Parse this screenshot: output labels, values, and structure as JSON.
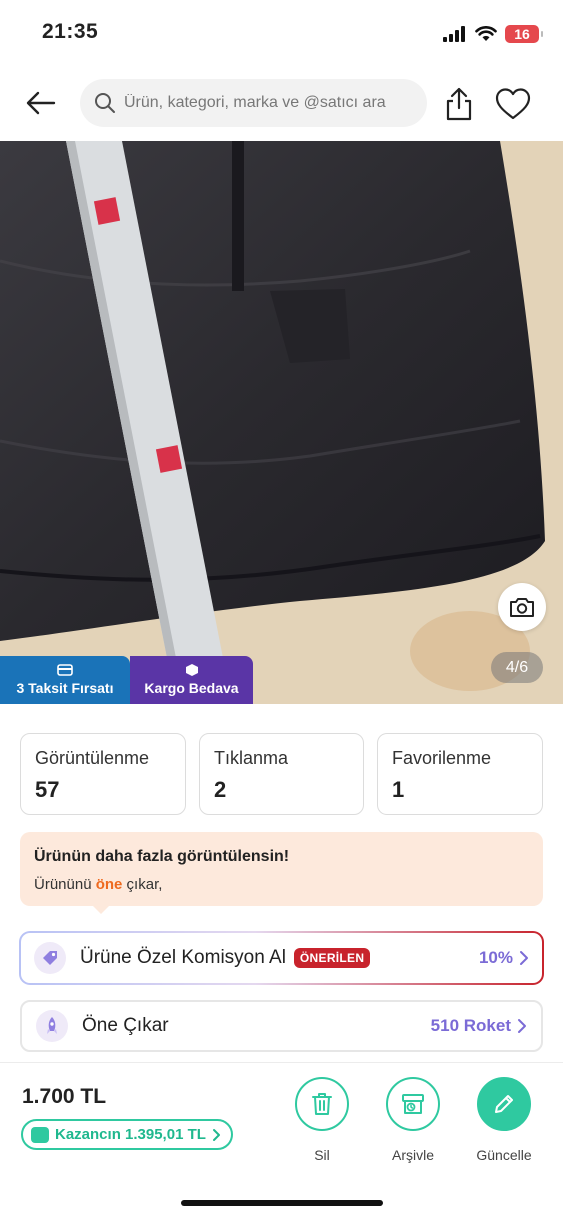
{
  "status_bar": {
    "time": "21:35",
    "battery": "16"
  },
  "header": {
    "search_placeholder": "Ürün, kategori, marka ve @satıcı ara"
  },
  "gallery": {
    "counter": "4/6",
    "badges": [
      {
        "label": "3 Taksit Fırsatı",
        "icon": "credit-card-icon"
      },
      {
        "label": "Kargo Bedava",
        "icon": "package-icon"
      }
    ]
  },
  "stats": [
    {
      "label": "Görüntülenme",
      "value": "57"
    },
    {
      "label": "Tıklanma",
      "value": "2"
    },
    {
      "label": "Favorilenme",
      "value": "1"
    }
  ],
  "promo": {
    "title": "Ürünün daha fazla görüntülensin!",
    "sub_before": "Ürününü ",
    "sub_highlight": "öne",
    "sub_after": " çıkar,"
  },
  "options": {
    "komisyon": {
      "label": "Ürüne Özel Komisyon Al",
      "badge": "ÖNERİLEN",
      "value": "10%"
    },
    "one_cikar": {
      "label": "Öne Çıkar",
      "value": "510 Roket"
    }
  },
  "bottom": {
    "price": "1.700 TL",
    "kazanc": "Kazancın 1.395,01 TL",
    "actions": [
      {
        "label": "Sil",
        "icon": "trash-icon"
      },
      {
        "label": "Arşivle",
        "icon": "archive-icon"
      },
      {
        "label": "Güncelle",
        "icon": "pencil-icon"
      }
    ]
  },
  "colors": {
    "accent_green": "#2fc9a0",
    "accent_purple": "#7b6bd6",
    "highlight_orange": "#ee6a1f",
    "recommended_red": "#c8232c"
  }
}
